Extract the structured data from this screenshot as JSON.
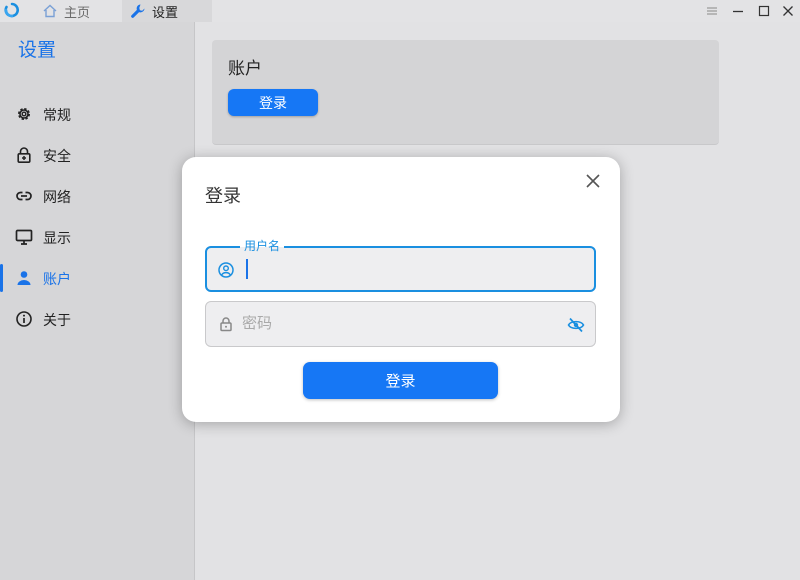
{
  "titlebar": {
    "tabs": [
      {
        "label": "主页",
        "icon": "home-icon"
      },
      {
        "label": "设置",
        "icon": "wrench-icon"
      }
    ],
    "controls": [
      "menu-icon",
      "minimize-icon",
      "maximize-icon",
      "close-icon"
    ]
  },
  "sidebar": {
    "title": "设置",
    "items": [
      {
        "label": "常规",
        "icon": "gear-icon"
      },
      {
        "label": "安全",
        "icon": "lock-plus-icon"
      },
      {
        "label": "网络",
        "icon": "link-icon"
      },
      {
        "label": "显示",
        "icon": "monitor-icon"
      },
      {
        "label": "账户",
        "icon": "person-icon",
        "active": true
      },
      {
        "label": "关于",
        "icon": "info-icon"
      }
    ]
  },
  "main": {
    "account_card": {
      "title": "账户",
      "login_button": "登录"
    }
  },
  "dialog": {
    "title": "登录",
    "username": {
      "label": "用户名",
      "value": ""
    },
    "password": {
      "placeholder": "密码",
      "value": ""
    },
    "submit_label": "登录"
  },
  "colors": {
    "accent": "#1a73e8",
    "button": "#1677f5",
    "sidebar_bg": "#d6d6d8",
    "app_bg": "#e2e2e4"
  }
}
